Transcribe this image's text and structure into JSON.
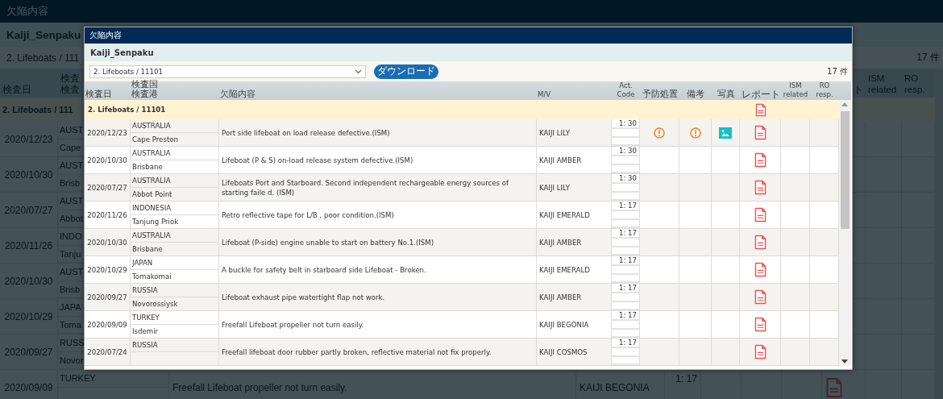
{
  "background_page": {
    "title": "欠陥内容",
    "company": "Kaiji_Senpaku",
    "filter": "2. Lifeboats / 111",
    "count": "17 件",
    "header": {
      "date": [
        "検査日"
      ],
      "place": [
        "検査",
        "検査"
      ],
      "report": [
        "ト"
      ],
      "ism": [
        "ISM",
        "related"
      ],
      "ro": [
        "RO",
        "resp."
      ]
    },
    "group": "2. Lifeboats / 111",
    "rows": [
      {
        "date": "2020/12/23",
        "country": "AUST",
        "port": "Cape"
      },
      {
        "date": "2020/10/30",
        "country": "AUST",
        "port": "Brisb"
      },
      {
        "date": "2020/07/27",
        "country": "AUST",
        "port": "Abbot"
      },
      {
        "date": "2020/11/26",
        "country": "INDO",
        "port": "Tanju"
      },
      {
        "date": "2020/10/30",
        "country": "AUST",
        "port": "Brisb"
      },
      {
        "date": "2020/10/29",
        "country": "JAPA",
        "port": "Toma"
      },
      {
        "date": "2020/09/27",
        "country": "RUSS",
        "port": "Novor"
      },
      {
        "date": "2020/09/09",
        "country": "TURKEY",
        "defect": "Freefall Lifeboat propeller not turn easily.",
        "vessel": "KAIJI BEGONIA",
        "act_code": "1: 17",
        "report": true
      }
    ]
  },
  "dialog": {
    "title": "欠陥内容",
    "company": "Kaiji_Senpaku",
    "filter": "2. Lifeboats / 11101",
    "download_button": "ダウンロード",
    "count": "17 件",
    "columns": [
      {
        "lines": [
          "検査日"
        ]
      },
      {
        "lines": [
          "検査国",
          "検査港"
        ]
      },
      {
        "lines": [
          "欠陥内容"
        ]
      },
      {
        "lines": [
          "M/V"
        ]
      },
      {
        "lines": [
          "Act.",
          "Code"
        ]
      },
      {
        "lines": [
          "予防処置"
        ]
      },
      {
        "lines": [
          "備考"
        ]
      },
      {
        "lines": [
          "写真"
        ]
      },
      {
        "lines": [
          "レポート"
        ]
      },
      {
        "lines": [
          "ISM",
          "related"
        ]
      },
      {
        "lines": [
          "RO",
          "resp."
        ]
      }
    ],
    "group": {
      "label": "2. Lifeboats / 11101",
      "report": true
    },
    "rows": [
      {
        "date": "2020/12/23",
        "country": "AUSTRALIA",
        "port": "Cape Preston",
        "defect": "Port side lifeboat on load release defective.(ISM)",
        "vessel": "KAIJI LILY",
        "act_code": "1: 30",
        "prevention": true,
        "remarks": true,
        "photo": true,
        "report": true
      },
      {
        "date": "2020/10/30",
        "country": "AUSTRALIA",
        "port": "Brisbane",
        "defect": "Lifeboat (P & S) on-load release system defective.(ISM)",
        "vessel": "KAIJI AMBER",
        "act_code": "1: 30",
        "prevention": false,
        "remarks": false,
        "photo": false,
        "report": true
      },
      {
        "date": "2020/07/27",
        "country": "AUSTRALIA",
        "port": "Abbot Point",
        "defect": "Lifeboats Port and Starboard. Second independent rechargeable energy sources of starting faile d. (ISM)",
        "vessel": "KAIJI LILY",
        "act_code": "1: 30",
        "prevention": false,
        "remarks": false,
        "photo": false,
        "report": true
      },
      {
        "date": "2020/11/26",
        "country": "INDONESIA",
        "port": "Tanjung Priok",
        "defect": "Retro reflective tape for L/B , poor condition.(ISM)",
        "vessel": "KAIJI EMERALD",
        "act_code": "1: 17",
        "prevention": false,
        "remarks": false,
        "photo": false,
        "report": true
      },
      {
        "date": "2020/10/30",
        "country": "AUSTRALIA",
        "port": "Brisbane",
        "defect": "Lifeboat (P-side) engine unable to start on battery No.1.(ISM)",
        "vessel": "KAIJI AMBER",
        "act_code": "1: 17",
        "prevention": false,
        "remarks": false,
        "photo": false,
        "report": true
      },
      {
        "date": "2020/10/29",
        "country": "JAPAN",
        "port": "Tomakomai",
        "defect": "A buckle for safety belt in starboard side Lifeboat - Broken.",
        "vessel": "KAIJI EMERALD",
        "act_code": "1: 17",
        "prevention": false,
        "remarks": false,
        "photo": false,
        "report": true
      },
      {
        "date": "2020/09/27",
        "country": "RUSSIA",
        "port": "Novorossiysk",
        "defect": "Lifeboat exhaust pipe watertight flap not work.",
        "vessel": "KAIJI AMBER",
        "act_code": "1: 17",
        "prevention": false,
        "remarks": false,
        "photo": false,
        "report": true
      },
      {
        "date": "2020/09/09",
        "country": "TURKEY",
        "port": "Isdemir",
        "defect": "Freefall Lifeboat propeller not turn easily.",
        "vessel": "KAIJI BEGONIA",
        "act_code": "1: 17",
        "prevention": false,
        "remarks": false,
        "photo": false,
        "report": true
      },
      {
        "date": "2020/07/24",
        "country": "RUSSIA",
        "defect": "Freefall lifeboat door rubber partly broken, reflective material not fix properly.",
        "vessel": "KAIJI COSMOS",
        "act_code": "1: 17",
        "prevention": false,
        "remarks": false,
        "photo": false,
        "report": true
      }
    ]
  }
}
